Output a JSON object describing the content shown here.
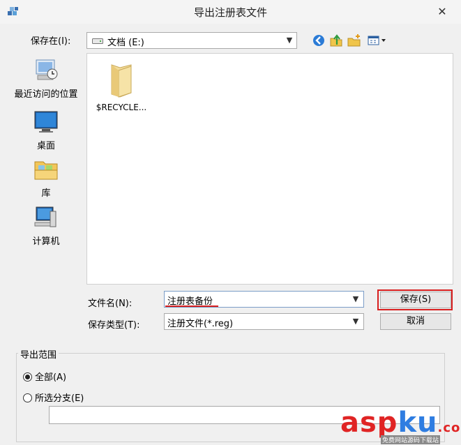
{
  "window": {
    "title": "导出注册表文件",
    "close_glyph": "✕"
  },
  "location": {
    "label": "保存在(I):",
    "value": "文档 (E:)"
  },
  "toolbar": {
    "icons": [
      "back-icon",
      "up-folder-icon",
      "new-folder-icon",
      "view-menu-icon"
    ]
  },
  "places": [
    {
      "label": "最近访问的位置",
      "icon": "recent-places-icon"
    },
    {
      "label": "桌面",
      "icon": "desktop-icon"
    },
    {
      "label": "库",
      "icon": "libraries-icon"
    },
    {
      "label": "计算机",
      "icon": "computer-icon"
    }
  ],
  "files": [
    {
      "name": "$RECYCLE...",
      "icon": "folder-icon"
    }
  ],
  "filename": {
    "label": "文件名(N):",
    "value": "注册表备份"
  },
  "filetype": {
    "label": "保存类型(T):",
    "value": "注册文件(*.reg)"
  },
  "buttons": {
    "save": "保存(S)",
    "cancel": "取消"
  },
  "export_range": {
    "legend": "导出范围",
    "options": [
      {
        "label": "全部(A)",
        "selected": true
      },
      {
        "label": "所选分支(E)",
        "selected": false
      }
    ],
    "branch_value": ""
  },
  "watermark": {
    "part1": "asp",
    "part2": "ku",
    "part3": ".com",
    "sub": "免费网站源码下载站",
    "color1": "#e02424",
    "color2": "#2f7de1"
  },
  "colors": {
    "highlight": "#d81e1e"
  }
}
